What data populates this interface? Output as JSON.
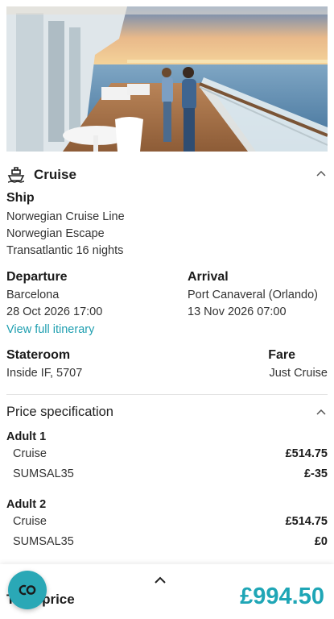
{
  "cruise": {
    "section_title": "Cruise",
    "ship_label": "Ship",
    "ship_lines": [
      "Norwegian Cruise Line",
      "Norwegian Escape",
      "Transatlantic 16 nights"
    ],
    "departure_label": "Departure",
    "departure_port": "Barcelona",
    "departure_time": "28 Oct 2026 17:00",
    "itinerary_link": "View full itinerary",
    "arrival_label": "Arrival",
    "arrival_port": "Port Canaveral (Orlando)",
    "arrival_time": "13 Nov 2026 07:00",
    "stateroom_label": "Stateroom",
    "stateroom_value": "Inside IF, 5707",
    "fare_label": "Fare",
    "fare_value": "Just Cruise"
  },
  "price_spec": {
    "title": "Price specification",
    "groups": [
      {
        "name": "Adult 1",
        "rows": [
          {
            "label": "Cruise",
            "amount": "£514.75"
          },
          {
            "label": "SUMSAL35",
            "amount": "£-35"
          }
        ]
      },
      {
        "name": "Adult 2",
        "rows": [
          {
            "label": "Cruise",
            "amount": "£514.75"
          },
          {
            "label": "SUMSAL35",
            "amount": "£0"
          }
        ]
      }
    ]
  },
  "footer": {
    "total_label": "Total price",
    "total_amount": "£994.50",
    "fab_icon": "co-logo-icon"
  },
  "colors": {
    "accent": "#1fa6b6",
    "fab": "#2aa8b6",
    "link": "#1f9fb0"
  }
}
